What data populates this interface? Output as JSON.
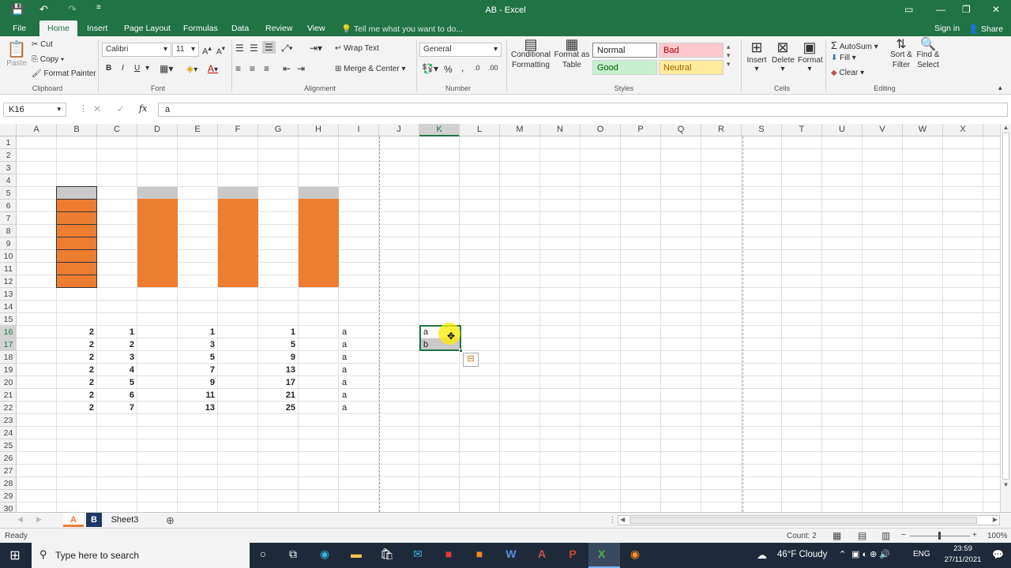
{
  "window": {
    "title": "AB - Excel"
  },
  "title_controls": {
    "save": "💾",
    "undo": "↶",
    "redo": "↷",
    "customize": "≡",
    "ribbon_display": "▭",
    "minimize": "—",
    "restore": "❐",
    "close": "✕"
  },
  "tabs": [
    "File",
    "Home",
    "Insert",
    "Page Layout",
    "Formulas",
    "Data",
    "Review",
    "View"
  ],
  "tell_me": "Tell me what you want to do...",
  "account": {
    "sign_in": "Sign in",
    "share": "Share"
  },
  "clipboard": {
    "paste": "Paste",
    "cut": "Cut",
    "copy": "Copy",
    "format_painter": "Format Painter",
    "label": "Clipboard"
  },
  "font": {
    "name": "Calibri",
    "size": "11",
    "label": "Font",
    "bold": "B",
    "italic": "I",
    "underline": "U"
  },
  "alignment": {
    "wrap": "Wrap Text",
    "merge": "Merge & Center",
    "label": "Alignment"
  },
  "number": {
    "format": "General",
    "percent": "%",
    "comma": ",",
    "label": "Number"
  },
  "styles": {
    "conditional": "Conditional Formatting",
    "format_table": "Format as Table",
    "normal": "Normal",
    "bad": "Bad",
    "good": "Good",
    "neutral": "Neutral",
    "label": "Styles"
  },
  "cells": {
    "insert": "Insert",
    "delete": "Delete",
    "format": "Format",
    "label": "Cells"
  },
  "editing": {
    "autosum": "AutoSum",
    "fill": "Fill",
    "clear": "Clear",
    "sort": "Sort & Filter",
    "find": "Find & Select",
    "label": "Editing"
  },
  "formula_bar": {
    "name_box": "K16",
    "fx": "fx",
    "value": "a"
  },
  "columns": [
    "A",
    "B",
    "C",
    "D",
    "E",
    "F",
    "G",
    "H",
    "I",
    "J",
    "K",
    "L",
    "M",
    "N",
    "O",
    "P",
    "Q",
    "R",
    "S",
    "T",
    "U",
    "V",
    "W",
    "X"
  ],
  "rows": [
    "1",
    "2",
    "3",
    "4",
    "5",
    "6",
    "7",
    "8",
    "9",
    "10",
    "11",
    "12",
    "13",
    "14",
    "15",
    "16",
    "17",
    "18",
    "19",
    "20",
    "21",
    "22",
    "23",
    "24",
    "25",
    "26",
    "27",
    "28",
    "29",
    "30"
  ],
  "table": {
    "B": [
      "2",
      "2",
      "2",
      "2",
      "2",
      "2",
      "2"
    ],
    "C": [
      "1",
      "2",
      "3",
      "4",
      "5",
      "6",
      "7"
    ],
    "E": [
      "1",
      "3",
      "5",
      "7",
      "9",
      "11",
      "13"
    ],
    "G": [
      "1",
      "5",
      "9",
      "13",
      "17",
      "21",
      "25"
    ],
    "I": [
      "a",
      "a",
      "a",
      "a",
      "a",
      "a",
      "a"
    ]
  },
  "selection": {
    "k16": "a",
    "k17": "b"
  },
  "sheets": [
    "A",
    "B",
    "Sheet3"
  ],
  "status": {
    "ready": "Ready",
    "count": "Count: 2",
    "zoom": "100%"
  },
  "taskbar": {
    "search": "Type here to search",
    "weather": "46°F Cloudy",
    "lang": "ENG",
    "time": "23:59",
    "date": "27/11/2021"
  },
  "colors": {
    "excel_green": "#217346",
    "orange_fill": "#ed7d31",
    "gray_fill": "#c9c9c9"
  }
}
